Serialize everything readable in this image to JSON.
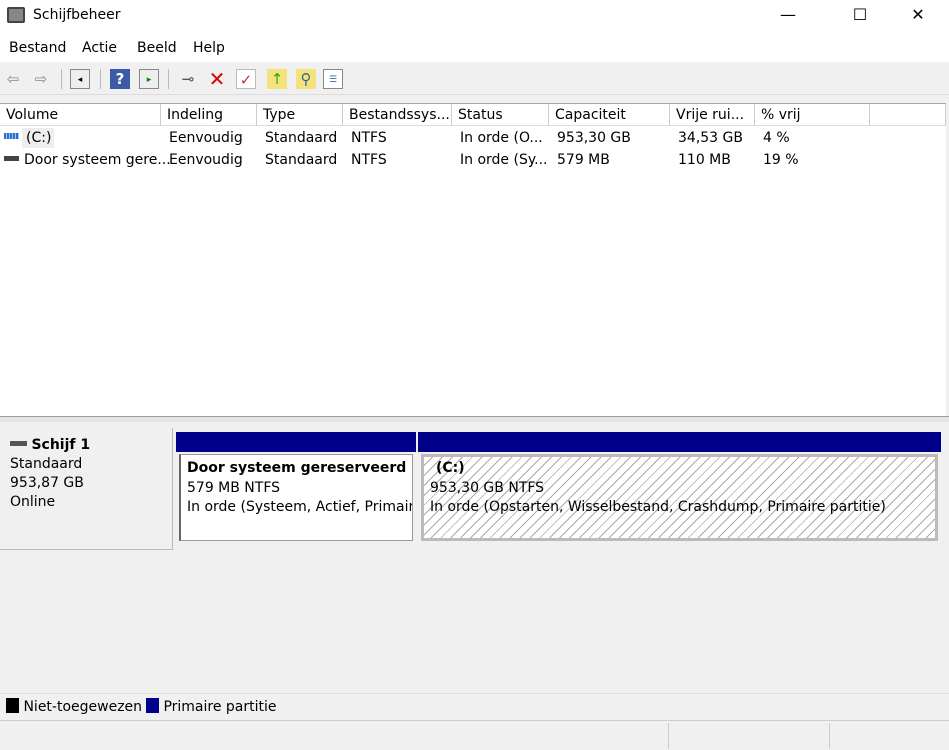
{
  "window": {
    "title": "Schijfbeheer",
    "minimize": "—",
    "maximize": "☐",
    "close": "✕"
  },
  "menu": [
    "Bestand",
    "Actie",
    "Beeld",
    "Help"
  ],
  "toolbar": [
    "back-icon",
    "forward-icon",
    "console-tree-icon",
    "help-icon",
    "action-pane-icon",
    "connect-drive-icon",
    "delete-icon",
    "properties-icon",
    "up-folder-icon",
    "search-folder-icon",
    "list-view-icon"
  ],
  "columns": [
    "Volume",
    "Indeling",
    "Type",
    "Bestandssys...",
    "Status",
    "Capaciteit",
    "Vrije rui...",
    "% vrij"
  ],
  "rows": [
    [
      "(C:)",
      "Eenvoudig",
      "Standaard",
      "NTFS",
      "In orde (O...",
      "953,30 GB",
      "34,53 GB",
      "4 %"
    ],
    [
      "Door systeem gere...",
      "Eenvoudig",
      "Standaard",
      "NTFS",
      "In orde (Sy...",
      "579 MB",
      "110 MB",
      "19 %"
    ]
  ],
  "disk": {
    "name": "Schijf 1",
    "type": "Standaard",
    "size": "953,87 GB",
    "state": "Online"
  },
  "partitions": [
    {
      "name": "Door systeem gereserveerd",
      "size": "579 MB NTFS",
      "status": "In orde (Systeem, Actief, Primaire partitie)"
    },
    {
      "name": "(C:)",
      "size": "953,30 GB NTFS",
      "status": "In orde (Opstarten, Wisselbestand, Crashdump, Primaire partitie)"
    }
  ],
  "legend": [
    {
      "label": "Niet-toegewezen",
      "color": "#000000"
    },
    {
      "label": "Primaire partitie",
      "color": "#00008b"
    }
  ]
}
